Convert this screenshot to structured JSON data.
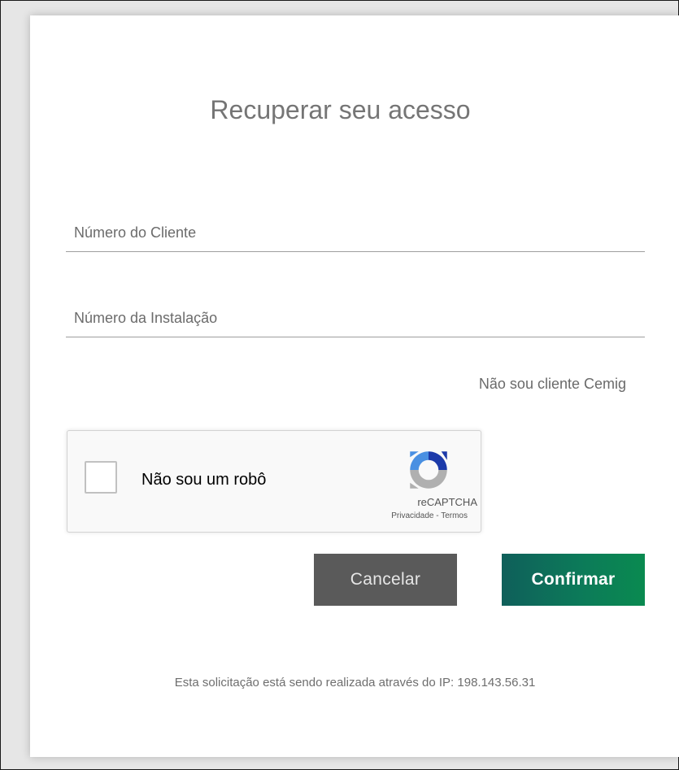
{
  "page": {
    "title": "Recuperar seu acesso"
  },
  "form": {
    "client_number": {
      "placeholder": "Número do Cliente",
      "value": ""
    },
    "installation_number": {
      "placeholder": "Número da Instalação",
      "value": ""
    },
    "not_client_link": "Não sou cliente Cemig"
  },
  "recaptcha": {
    "label": "Não sou um robô",
    "brand": "reCAPTCHA",
    "privacy": "Privacidade",
    "separator": " - ",
    "terms": "Termos",
    "checked": false,
    "logo_icon": "recaptcha-logo-icon"
  },
  "buttons": {
    "cancel": "Cancelar",
    "confirm": "Confirmar"
  },
  "footer": {
    "ip_note": "Esta solicitação está sendo realizada através do IP: 198.143.56.31"
  },
  "colors": {
    "cancel_bg": "#5a5a5a",
    "confirm_bg_start": "#0f5f5a",
    "confirm_bg_end": "#0a8a50",
    "title_text": "#757575"
  }
}
